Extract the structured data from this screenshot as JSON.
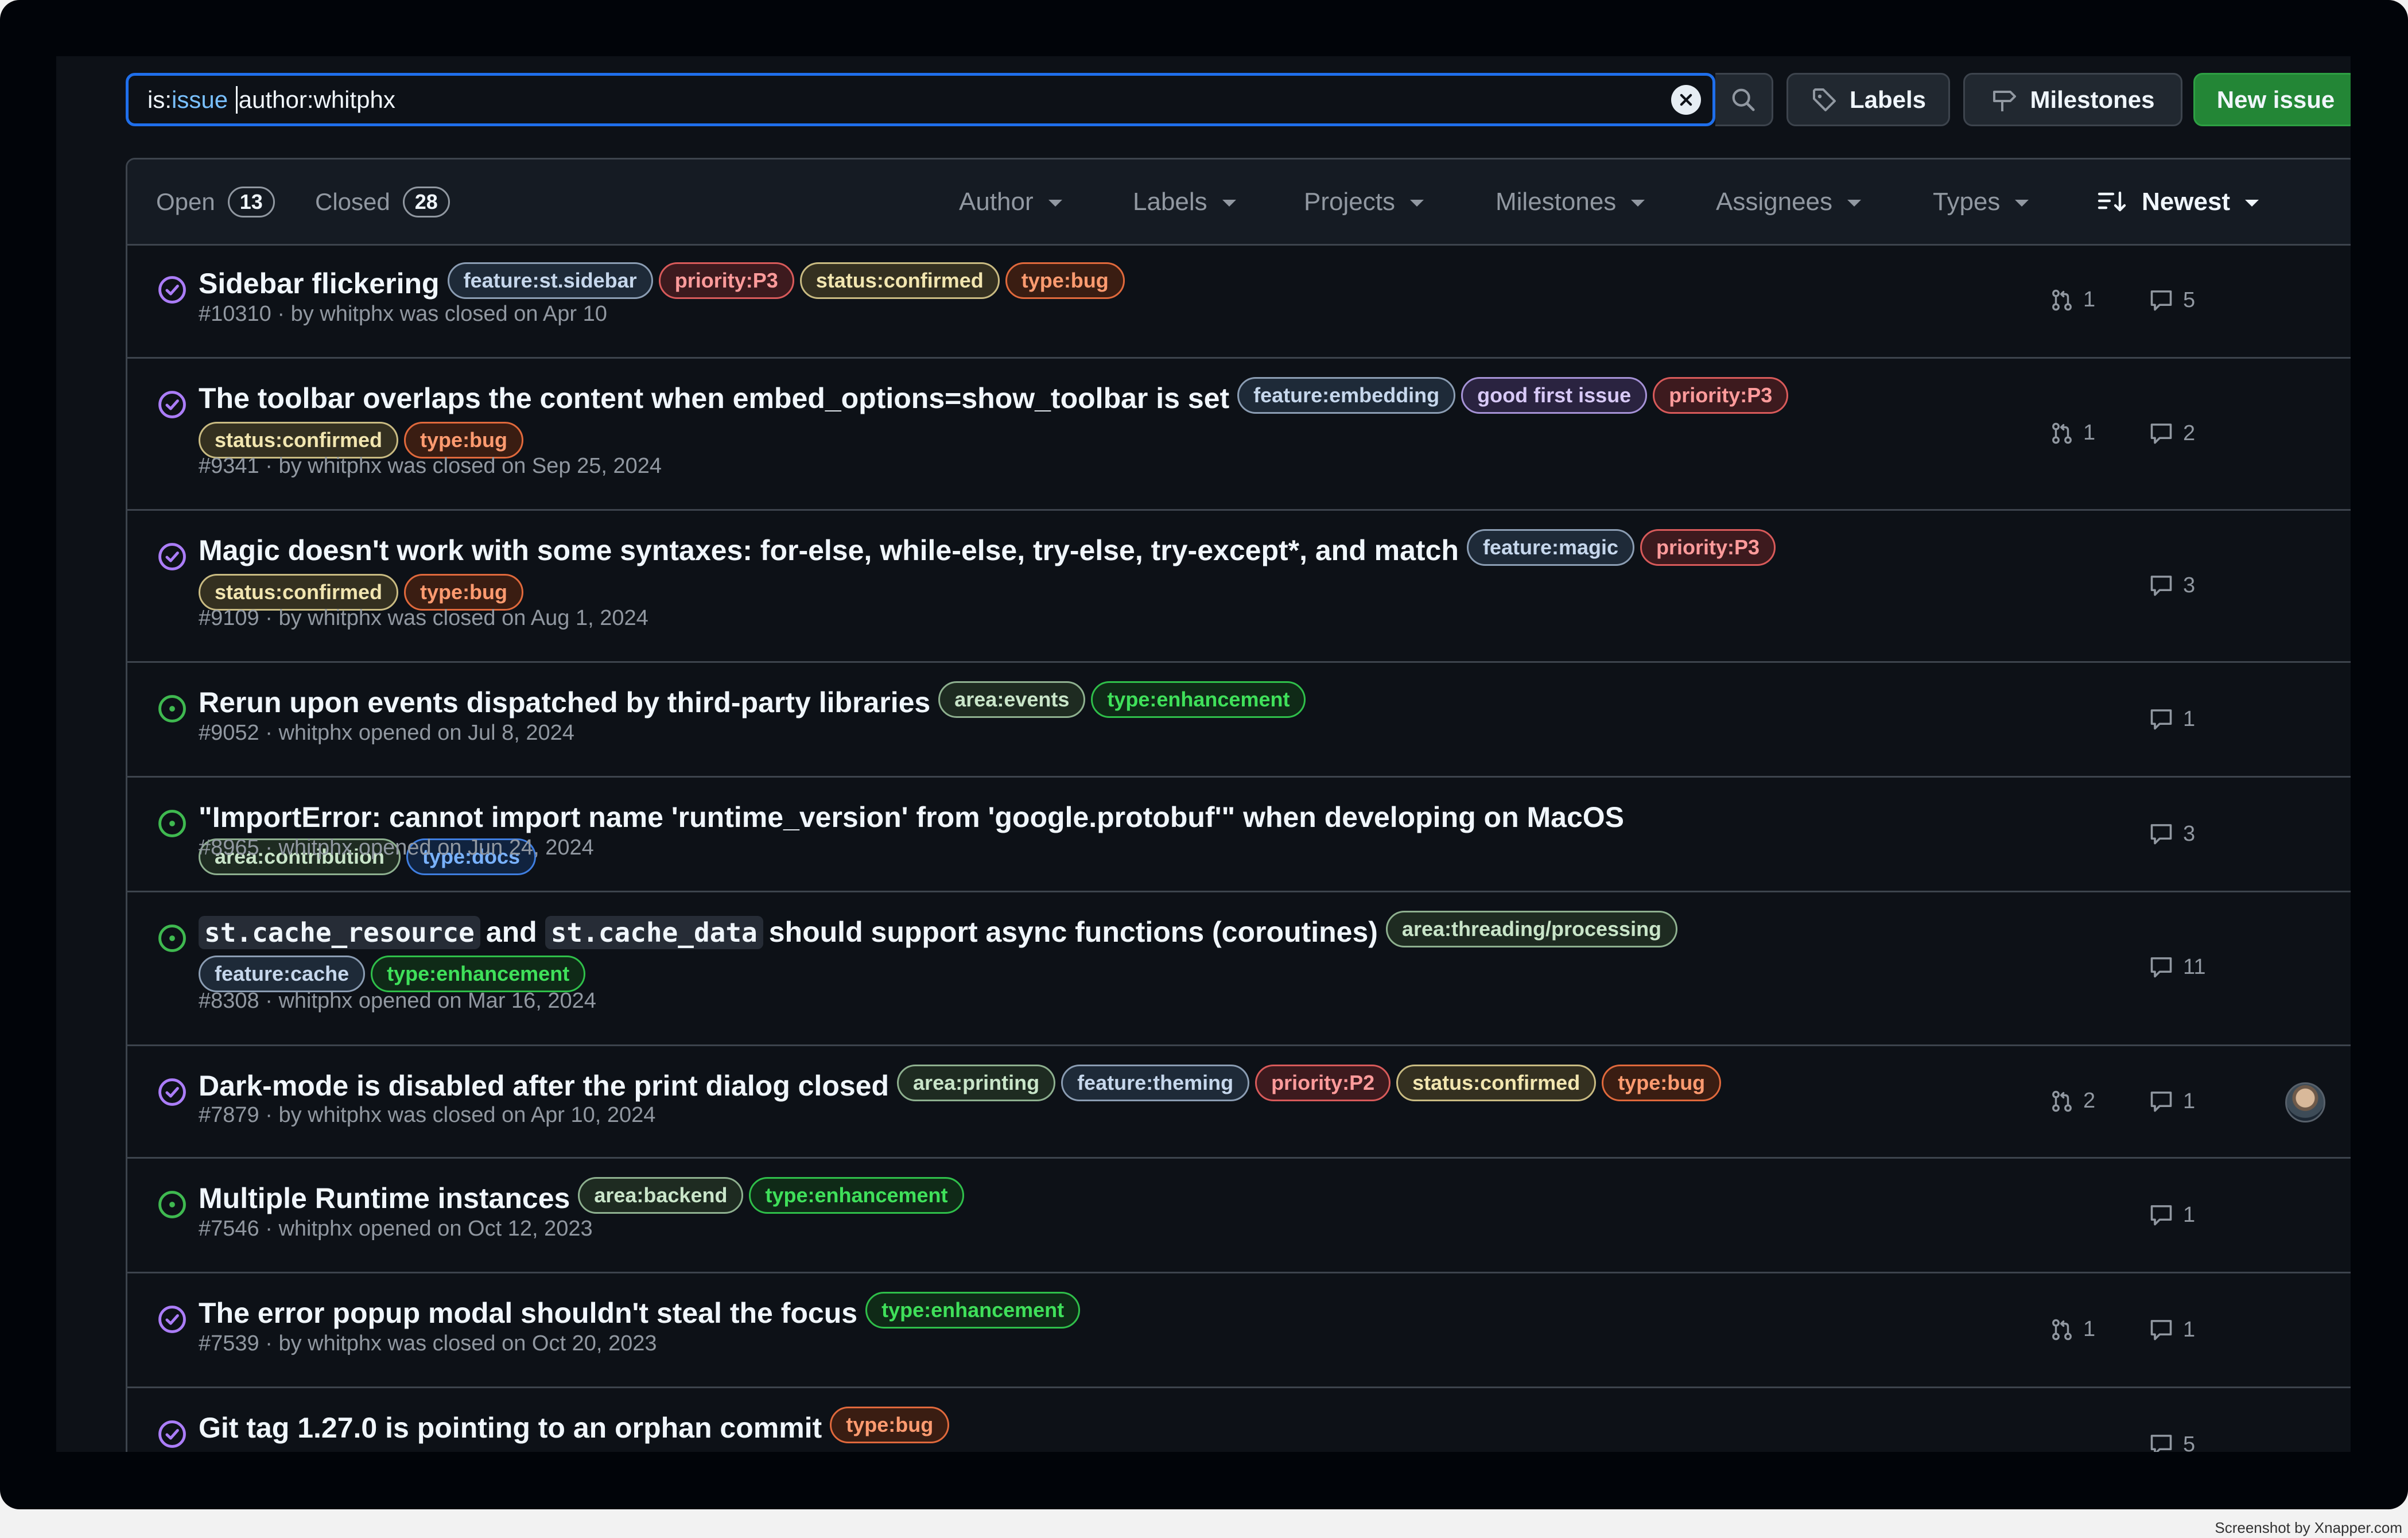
{
  "search": {
    "query_prefix": "is:",
    "query_value": "issue",
    "query_rest": "author:whitphx"
  },
  "toolbar": {
    "labels_label": "Labels",
    "milestones_label": "Milestones",
    "new_issue_label": "New issue"
  },
  "states": {
    "open_label": "Open",
    "open_count": "13",
    "closed_label": "Closed",
    "closed_count": "28"
  },
  "filters": {
    "author": "Author",
    "labels": "Labels",
    "projects": "Projects",
    "milestones": "Milestones",
    "assignees": "Assignees",
    "types": "Types",
    "sort": "Newest"
  },
  "label_colors": {
    "feature:st.sidebar": {
      "fg": "#c6d7ec",
      "bg": "#1e2a38",
      "bd": "#8b9db3"
    },
    "feature:embedding": {
      "fg": "#c6d7ec",
      "bg": "#1e2a38",
      "bd": "#8b9db3"
    },
    "feature:magic": {
      "fg": "#c6d7ec",
      "bg": "#1e2a38",
      "bd": "#8b9db3"
    },
    "feature:cache": {
      "fg": "#c6d7ec",
      "bg": "#1e2a38",
      "bd": "#8b9db3"
    },
    "feature:theming": {
      "fg": "#c6d7ec",
      "bg": "#1e2a38",
      "bd": "#8b9db3"
    },
    "priority:P3": {
      "fg": "#ff9b9b",
      "bg": "#3d1a1e",
      "bd": "#d85a5a"
    },
    "priority:P2": {
      "fg": "#ff9b9b",
      "bg": "#3d1a1e",
      "bd": "#d85a5a"
    },
    "status:confirmed": {
      "fg": "#f2e6b0",
      "bg": "#343020",
      "bd": "#c9bb82"
    },
    "type:bug": {
      "fg": "#ff9b70",
      "bg": "#3a1d12",
      "bd": "#e0693c"
    },
    "good first issue": {
      "fg": "#d8c9f7",
      "bg": "#2a2340",
      "bd": "#a592d6"
    },
    "area:events": {
      "fg": "#c9e5c9",
      "bg": "#1e2b21",
      "bd": "#8eb08f"
    },
    "area:contribution": {
      "fg": "#c9e5c9",
      "bg": "#1e2b21",
      "bd": "#8eb08f"
    },
    "area:threading/processing": {
      "fg": "#c9e5c9",
      "bg": "#1e2b21",
      "bd": "#8eb08f"
    },
    "area:printing": {
      "fg": "#c9e5c9",
      "bg": "#1e2b21",
      "bd": "#8eb08f"
    },
    "area:backend": {
      "fg": "#c9e5c9",
      "bg": "#1e2b21",
      "bd": "#8eb08f"
    },
    "type:enhancement": {
      "fg": "#3fe05a",
      "bg": "#0f2a17",
      "bd": "#2fbf4a"
    },
    "type:docs": {
      "fg": "#79b2ff",
      "bg": "#10233f",
      "bd": "#3f7ee0"
    }
  },
  "state_colors": {
    "closed": "#ab7df8",
    "open": "#3fb950"
  },
  "issues": [
    {
      "state": "closed",
      "title_parts": [
        {
          "t": "Sidebar flickering"
        }
      ],
      "labels": [
        "feature:st.sidebar",
        "priority:P3",
        "status:confirmed",
        "type:bug"
      ],
      "meta": "#10310 · by whitphx was closed on Apr 10",
      "prs": "1",
      "comments": "5",
      "avatar": false
    },
    {
      "state": "closed",
      "title_parts": [
        {
          "t": "The toolbar overlaps the content when embed_options=show_toolbar is set"
        }
      ],
      "labels": [
        "feature:embedding",
        "good first issue",
        "priority:P3",
        "status:confirmed",
        "type:bug"
      ],
      "meta": "#9341 · by whitphx was closed on Sep 25, 2024",
      "prs": "1",
      "comments": "2",
      "avatar": false
    },
    {
      "state": "closed",
      "title_parts": [
        {
          "t": "Magic doesn't work with some syntaxes: for-else, while-else, try-else, try-except*, and match"
        }
      ],
      "labels": [
        "feature:magic",
        "priority:P3",
        "status:confirmed",
        "type:bug"
      ],
      "meta": "#9109 · by whitphx was closed on Aug 1, 2024",
      "prs": "",
      "comments": "3",
      "avatar": false
    },
    {
      "state": "open",
      "title_parts": [
        {
          "t": "Rerun upon events dispatched by third-party libraries"
        }
      ],
      "labels": [
        "area:events",
        "type:enhancement"
      ],
      "meta": "#9052 · whitphx opened on Jul 8, 2024",
      "prs": "",
      "comments": "1",
      "avatar": false
    },
    {
      "state": "open",
      "title_parts": [
        {
          "t": "\"ImportError: cannot import name 'runtime_version' from 'google.protobuf'\" when developing on MacOS"
        }
      ],
      "labels": [
        "area:contribution",
        "type:docs"
      ],
      "meta": "#8965 · whitphx opened on Jun 24, 2024",
      "prs": "",
      "comments": "3",
      "avatar": false
    },
    {
      "state": "open",
      "title_parts": [
        {
          "t": "st.cache_resource",
          "code": true
        },
        {
          "t": "and"
        },
        {
          "t": "st.cache_data",
          "code": true
        },
        {
          "t": "should support async functions (coroutines)"
        }
      ],
      "labels": [
        "area:threading/processing",
        "feature:cache",
        "type:enhancement"
      ],
      "meta": "#8308 · whitphx opened on Mar 16, 2024",
      "prs": "",
      "comments": "11",
      "avatar": false
    },
    {
      "state": "closed",
      "title_parts": [
        {
          "t": "Dark-mode is disabled after the print dialog closed"
        }
      ],
      "labels": [
        "area:printing",
        "feature:theming",
        "priority:P2",
        "status:confirmed",
        "type:bug"
      ],
      "meta": "#7879 · by whitphx was closed on Apr 10, 2024",
      "prs": "2",
      "comments": "1",
      "avatar": true
    },
    {
      "state": "open",
      "title_parts": [
        {
          "t": "Multiple Runtime instances"
        }
      ],
      "labels": [
        "area:backend",
        "type:enhancement"
      ],
      "meta": "#7546 · whitphx opened on Oct 12, 2023",
      "prs": "",
      "comments": "1",
      "avatar": false
    },
    {
      "state": "closed",
      "title_parts": [
        {
          "t": "The error popup modal shouldn't steal the focus"
        }
      ],
      "labels": [
        "type:enhancement"
      ],
      "meta": "#7539 · by whitphx was closed on Oct 20, 2023",
      "prs": "1",
      "comments": "1",
      "avatar": false
    },
    {
      "state": "closed",
      "title_parts": [
        {
          "t": "Git tag 1.27.0 is pointing to an orphan commit"
        }
      ],
      "labels": [
        "type:bug"
      ],
      "meta": "",
      "prs": "",
      "comments": "5",
      "avatar": false
    }
  ],
  "watermark": "Screenshot by Xnapper.com"
}
